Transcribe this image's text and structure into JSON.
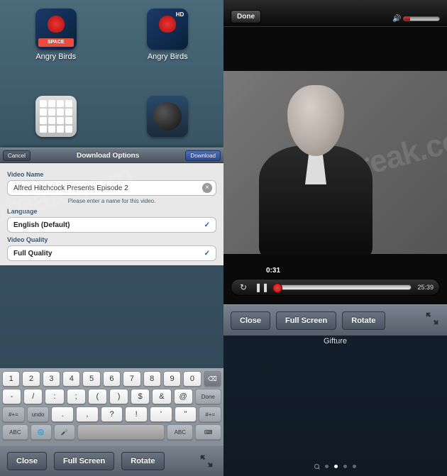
{
  "home": {
    "apps": [
      {
        "label": "Angry Birds",
        "badge": "SPACE"
      },
      {
        "label": "Angry Birds",
        "hd": "HD"
      }
    ]
  },
  "dialog": {
    "cancel": "Cancel",
    "title": "Download Options",
    "download": "Download",
    "video_name_label": "Video Name",
    "video_name_value": "Alfred Hitchcock Presents Episode 2",
    "helper": "Please enter a name for this video.",
    "language_label": "Language",
    "language_value": "English (Default)",
    "quality_label": "Video Quality",
    "quality_value": "Full Quality",
    "check": "✓"
  },
  "keyboard": {
    "row1": [
      "1",
      "2",
      "3",
      "4",
      "5",
      "6",
      "7",
      "8",
      "9",
      "0"
    ],
    "row2": [
      "-",
      "/",
      ":",
      ";",
      "(",
      ")",
      "$",
      "&",
      "@"
    ],
    "row3_mod": "#+=",
    "row3": [
      "undo",
      ".",
      ",",
      "?",
      "!",
      "'",
      "\""
    ],
    "row3_mod2": "#+=",
    "row4_abc1": "ABC",
    "row4_abc2": "ABC",
    "done": "Done",
    "hide": "⌨"
  },
  "toolbar": {
    "close": "Close",
    "fullscreen": "Full Screen",
    "rotate": "Rotate"
  },
  "player": {
    "done": "Done",
    "current_time": "0:31",
    "duration": "25:39",
    "watermark": "iJailbreak.com"
  },
  "gifture": "Gifture"
}
